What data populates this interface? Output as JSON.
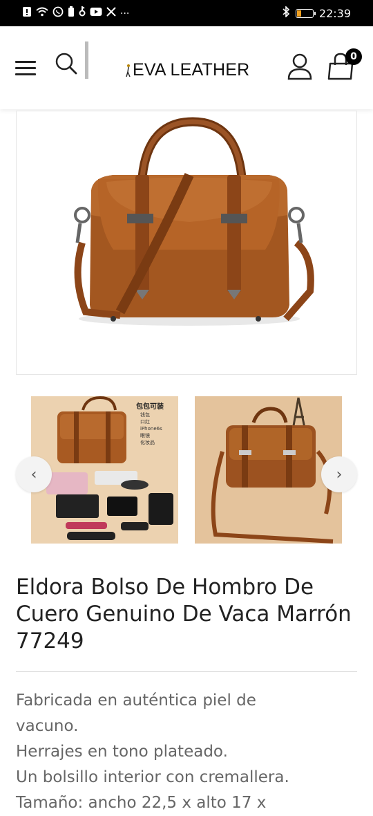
{
  "status_bar": {
    "icons": [
      "alert-icon",
      "wifi-icon",
      "whatsapp-icon",
      "battery-saver-icon",
      "device-icon",
      "youtube-icon",
      "x-icon",
      "more-icon"
    ],
    "more_text": "···",
    "right_icons": [
      "bluetooth-icon",
      "battery-icon"
    ],
    "time": "22:39"
  },
  "header": {
    "logo_text": "EVA LEATHER",
    "cart_count": "0"
  },
  "gallery": {
    "thumb1_caption_title": "包包可装",
    "thumb1_caption_items": [
      "钱包",
      "口红",
      "iPhone6s",
      "眼镜",
      "化妆品"
    ],
    "prev_symbol": "‹",
    "next_symbol": "›"
  },
  "product": {
    "title": "Eldora Bolso De Hombro De Cuero Genuino De Vaca Marrón 77249",
    "description_lines": [
      "Fabricada en auténtica piel de",
      "vacuno.",
      "Herrajes en tono plateado.",
      "Un bolsillo interior con cremallera.",
      "Tamaño: ancho 22,5 x alto 17 x"
    ]
  },
  "colors": {
    "leather": "#a85a22",
    "leather_dark": "#6e3510",
    "accent": "#000000"
  }
}
